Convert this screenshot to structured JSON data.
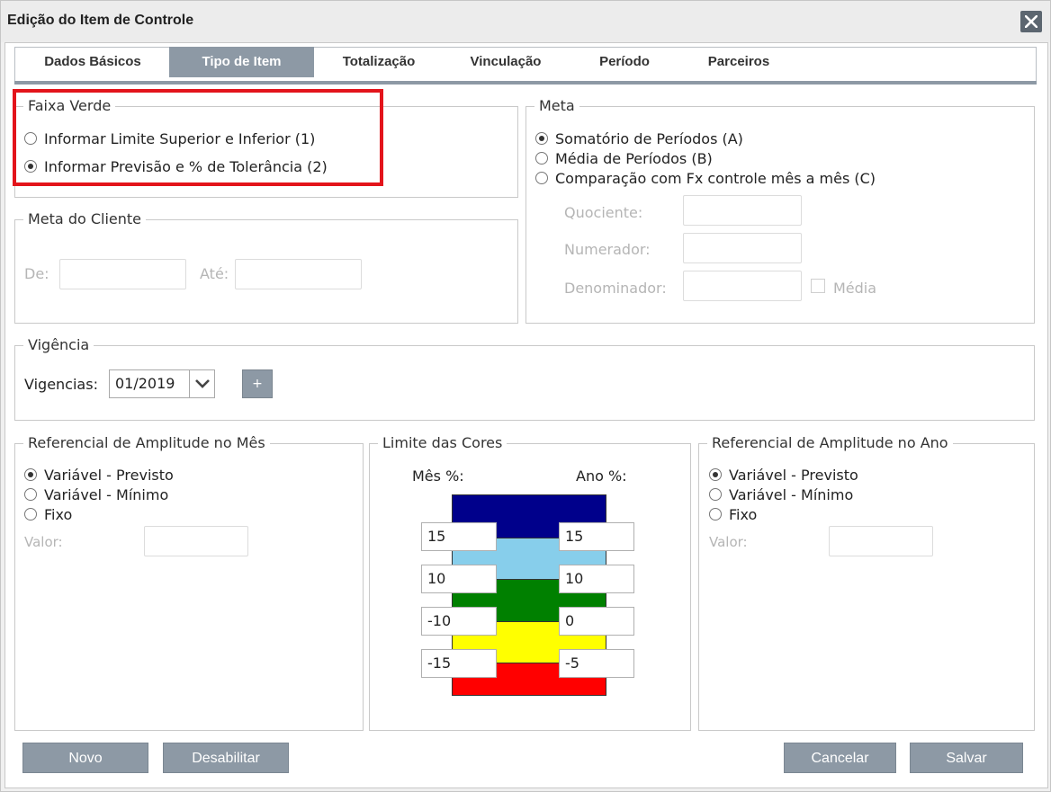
{
  "window": {
    "title": "Edição do Item de Controle",
    "close_icon": "close-icon"
  },
  "tabs": [
    {
      "label": "Dados Básicos",
      "active": false
    },
    {
      "label": "Tipo de Item",
      "active": true
    },
    {
      "label": "Totalização",
      "active": false
    },
    {
      "label": "Vinculação",
      "active": false
    },
    {
      "label": "Período",
      "active": false
    },
    {
      "label": "Parceiros",
      "active": false
    }
  ],
  "faixa_verde": {
    "legend": "Faixa Verde",
    "options": [
      {
        "label": "Informar Limite Superior e Inferior (1)",
        "checked": false
      },
      {
        "label": "Informar Previsão e % de Tolerância (2)",
        "checked": true
      }
    ],
    "highlight_color": "#e3141b"
  },
  "meta_cliente": {
    "legend": "Meta do Cliente",
    "de_label": "De:",
    "de_value": "",
    "ate_label": "Até:",
    "ate_value": ""
  },
  "meta": {
    "legend": "Meta",
    "options": [
      {
        "label": "Somatório de Períodos (A)",
        "checked": true
      },
      {
        "label": "Média de Períodos (B)",
        "checked": false
      },
      {
        "label": "Comparação com Fx controle mês a mês (C)",
        "checked": false
      }
    ],
    "quociente_label": "Quociente:",
    "numerador_label": "Numerador:",
    "denominador_label": "Denominador:",
    "media_label": "Média",
    "media_checked": false
  },
  "vigencia": {
    "legend": "Vigência",
    "vigencias_label": "Vigencias:",
    "selected": "01/2019",
    "add_label": "+"
  },
  "amplitude_mes": {
    "legend": "Referencial de Amplitude no Mês",
    "options": [
      {
        "label": "Variável - Previsto",
        "checked": true
      },
      {
        "label": "Variável - Mínimo",
        "checked": false
      },
      {
        "label": "Fixo",
        "checked": false
      }
    ],
    "valor_label": "Valor:",
    "valor_value": ""
  },
  "limite_cores": {
    "legend": "Limite das Cores",
    "mes_label": "Mês %:",
    "ano_label": "Ano %:",
    "bands": [
      {
        "color": "#00008b"
      },
      {
        "color": "#87ceeb"
      },
      {
        "color": "#008000"
      },
      {
        "color": "#ffff00"
      },
      {
        "color": "#ff0000"
      }
    ],
    "mes_values": [
      "15",
      "10",
      "-10",
      "-15"
    ],
    "ano_values": [
      "15",
      "10",
      "0",
      "-5"
    ]
  },
  "amplitude_ano": {
    "legend": "Referencial de Amplitude no Ano",
    "options": [
      {
        "label": "Variável - Previsto",
        "checked": true
      },
      {
        "label": "Variável - Mínimo",
        "checked": false
      },
      {
        "label": "Fixo",
        "checked": false
      }
    ],
    "valor_label": "Valor:",
    "valor_value": ""
  },
  "footer": {
    "novo": "Novo",
    "desabilitar": "Desabilitar",
    "cancelar": "Cancelar",
    "salvar": "Salvar"
  }
}
